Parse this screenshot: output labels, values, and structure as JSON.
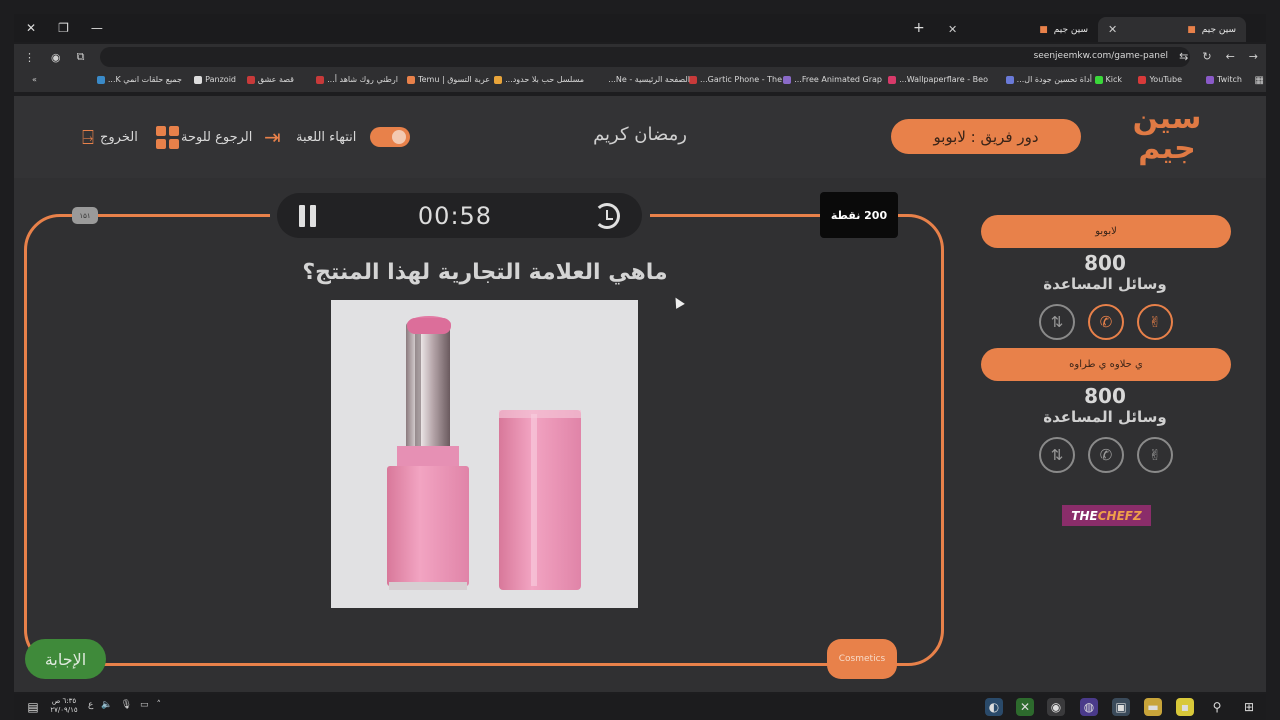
{
  "browser": {
    "tabs": [
      {
        "title": "سين جيم",
        "active": true
      },
      {
        "title": "سين جيم",
        "active": false
      }
    ],
    "url": "seenjeemkw.com/game-panel",
    "bookmarks": [
      "Twitch",
      "YouTube",
      "Kick",
      "أداة تحسين جودة ال...",
      "Wallpaperflare - Beo...",
      "Free Animated Grap...",
      "Gartic Phone - The...",
      "الصفحة الرئيسية - Ne...",
      "مسلسل حب بلا حدود...",
      "عربة التسوق | Temu",
      "ارطني روك شاهد أ...",
      "قصة عشق",
      "Panzoid",
      "جميع حلقات انمي K..."
    ]
  },
  "header": {
    "logo_text": "سين جيم",
    "turn_label": "دور فريق : لابوبو",
    "title": "رمضان كريم",
    "end_game": "انتهاء اللعبة",
    "back_to_board": "الرجوع للوحة",
    "exit": "الخروج"
  },
  "game": {
    "timer": "00:58",
    "points": "200 نقطة",
    "kbd": "۱۵۱",
    "question": "ماهي العلامة التجارية لهذا المنتج؟",
    "answer_button": "الإجابة",
    "category": "Cosmetics"
  },
  "teams": [
    {
      "name": "لابوبو",
      "score": "800",
      "aids_label": "وسائل المساعدة"
    },
    {
      "name": "ي حلاوه ي طراوه",
      "score": "800",
      "aids_label": "وسائل المساعدة"
    }
  ],
  "sponsor": {
    "part1": "THE",
    "part2": "CHEFZ"
  },
  "taskbar": {
    "time": "٦:٣٥ ص",
    "date": "٢٧/٠٩/١٥",
    "lang": "ع"
  },
  "colors": {
    "accent": "#e8814a",
    "answer": "#3f8a3a",
    "bg": "#303032"
  }
}
